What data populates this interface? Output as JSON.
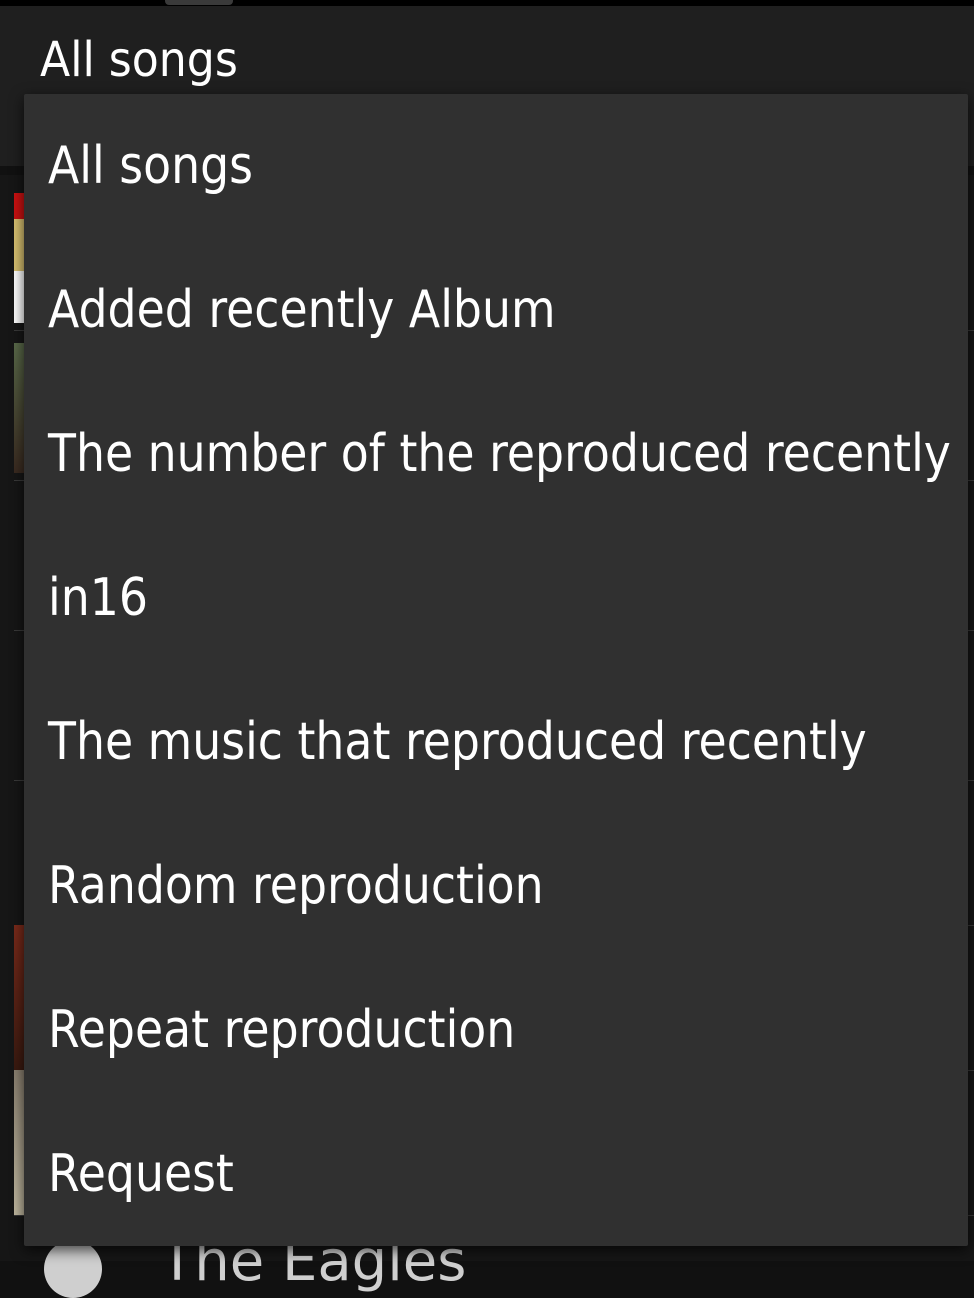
{
  "header": {
    "spinner_label": "All songs"
  },
  "dropdown": {
    "items": [
      {
        "label": "All songs"
      },
      {
        "label": "Added recently Album"
      },
      {
        "label": "The number of the reproduced recently"
      },
      {
        "label": "in16"
      },
      {
        "label": "The music that reproduced recently"
      },
      {
        "label": "Random reproduction"
      },
      {
        "label": "Repeat reproduction"
      },
      {
        "label": "Request"
      }
    ]
  },
  "background": {
    "footer_text": "The Eagles"
  },
  "colors": {
    "menu_background": "#303030",
    "actionbar_background": "#1f1f1f",
    "text": "#ffffff"
  }
}
